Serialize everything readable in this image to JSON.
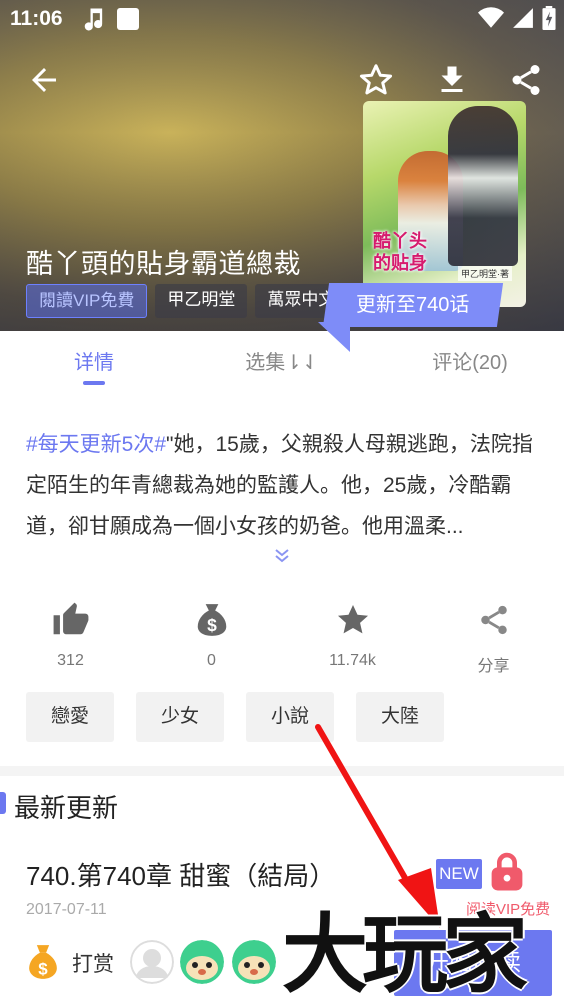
{
  "status_bar": {
    "time": "11:06"
  },
  "book": {
    "title": "酷丫頭的貼身霸道總裁",
    "tags": [
      "閱讀VIP免費",
      "甲乙明堂",
      "萬眾中文"
    ],
    "cover_title": "酷丫头的贴身",
    "cover_author": "甲乙明堂·著",
    "update_badge": "更新至740话"
  },
  "tabs": [
    {
      "label": "详情",
      "active": true
    },
    {
      "label": "选集⇂⇃",
      "active": false
    },
    {
      "label": "评论(20)",
      "active": false
    }
  ],
  "description": {
    "hashtag": "#每天更新5次#",
    "text": "\"她，15歲，父親殺人母親逃跑，法院指定陌生的年青總裁為她的監護人。他，25歲，冷酷霸道，卻甘願成為一個小女孩的奶爸。他用溫柔..."
  },
  "stats": [
    {
      "icon": "thumbs-up-icon",
      "value": "312"
    },
    {
      "icon": "money-bag-icon",
      "value": "0"
    },
    {
      "icon": "star-icon",
      "value": "11.74k"
    },
    {
      "icon": "share-icon",
      "value": "分享"
    }
  ],
  "genres": [
    "戀愛",
    "少女",
    "小說",
    "大陸"
  ],
  "latest": {
    "section_title": "最新更新",
    "chapter_title": "740.第740章 甜蜜（結局）",
    "date": "2017-07-11",
    "new_badge": "NEW",
    "vip_free": "阅读VIP免费"
  },
  "bottom": {
    "reward_label": "打赏",
    "start_label": "开始阅读"
  },
  "watermark": "大玩家",
  "colors": {
    "accent": "#6c78f0",
    "red": "#f05a6b"
  }
}
